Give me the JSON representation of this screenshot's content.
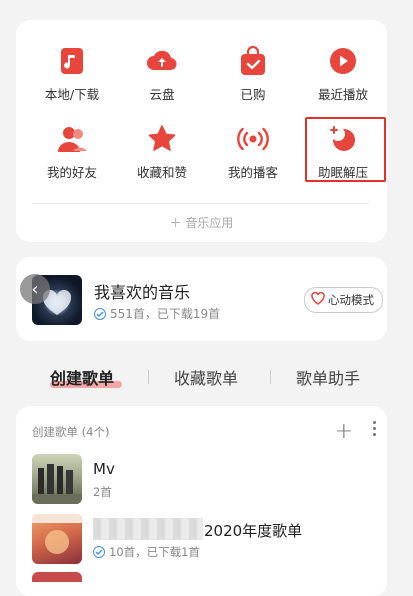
{
  "menu": {
    "items": [
      {
        "label": "本地/下载",
        "icon": "music-file-icon"
      },
      {
        "label": "云盘",
        "icon": "cloud-upload-icon"
      },
      {
        "label": "已购",
        "icon": "shopping-bag-icon"
      },
      {
        "label": "最近播放",
        "icon": "play-circle-icon"
      },
      {
        "label": "我的好友",
        "icon": "friends-icon"
      },
      {
        "label": "收藏和赞",
        "icon": "star-icon"
      },
      {
        "label": "我的播客",
        "icon": "podcast-icon"
      },
      {
        "label": "助眠解压",
        "icon": "moon-sleep-icon"
      }
    ],
    "add_apps": "＋ 音乐应用"
  },
  "favorites": {
    "title": "我喜欢的音乐",
    "subtitle": "551首，已下载19首",
    "mode_button": "心动模式"
  },
  "tabs": [
    "创建歌单",
    "收藏歌单",
    "歌单助手"
  ],
  "playlists_section": {
    "header": "创建歌单 (4个)",
    "items": [
      {
        "title": "Mv",
        "subtitle": "2首"
      },
      {
        "title": "2020年度歌单",
        "subtitle": "10首，已下载1首"
      }
    ]
  },
  "colors": {
    "accent": "#e8453c",
    "highlight_border": "#e4302b",
    "tab_underline": "#f3a8a8"
  }
}
